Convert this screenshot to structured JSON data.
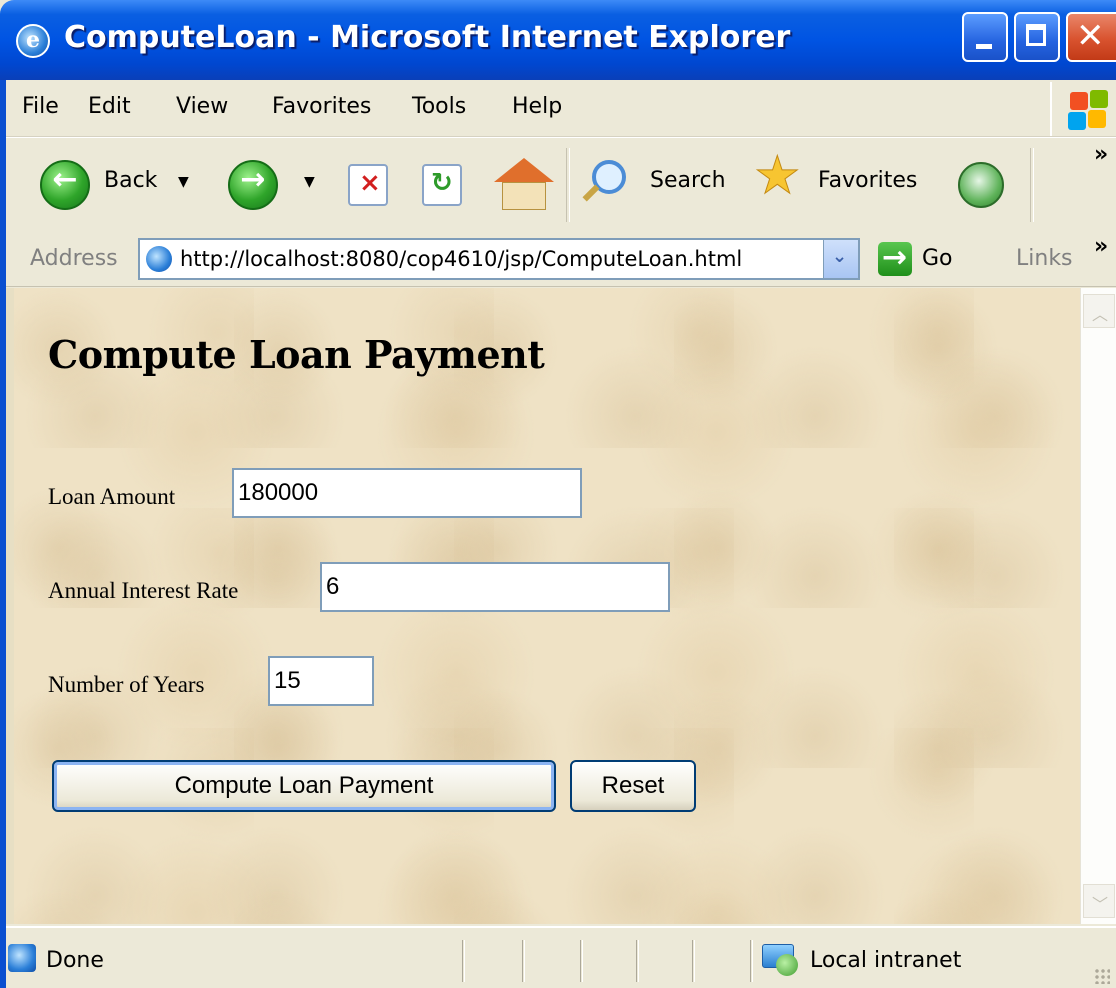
{
  "window": {
    "title": "ComputeLoan - Microsoft Internet Explorer",
    "title_icon_glyph": "e"
  },
  "menu": {
    "items": [
      {
        "label": "File"
      },
      {
        "label": "Edit"
      },
      {
        "label": "View"
      },
      {
        "label": "Favorites"
      },
      {
        "label": "Tools"
      },
      {
        "label": "Help"
      }
    ]
  },
  "toolbar": {
    "back_label": "Back",
    "search_label": "Search",
    "favorites_label": "Favorites",
    "dropdown_glyph": "▼",
    "more_glyph": "»"
  },
  "address": {
    "label": "Address",
    "url": "http://localhost:8080/cop4610/jsp/ComputeLoan.html",
    "go_label": "Go",
    "links_label": "Links"
  },
  "page": {
    "title": "Compute Loan Payment",
    "fields": {
      "loan_amount_label": "Loan Amount",
      "loan_amount_value": "180000",
      "interest_label": "Annual Interest Rate",
      "interest_value": "6",
      "years_label": "Number of Years",
      "years_value": "15"
    },
    "submit_label": "Compute Loan Payment",
    "reset_label": "Reset"
  },
  "status": {
    "text": "Done",
    "zone": "Local intranet"
  },
  "colors": {
    "title_bar": "#0054e3",
    "chrome": "#ece9d8",
    "page_background": "#efe2c5",
    "input_border": "#7f9db9"
  }
}
